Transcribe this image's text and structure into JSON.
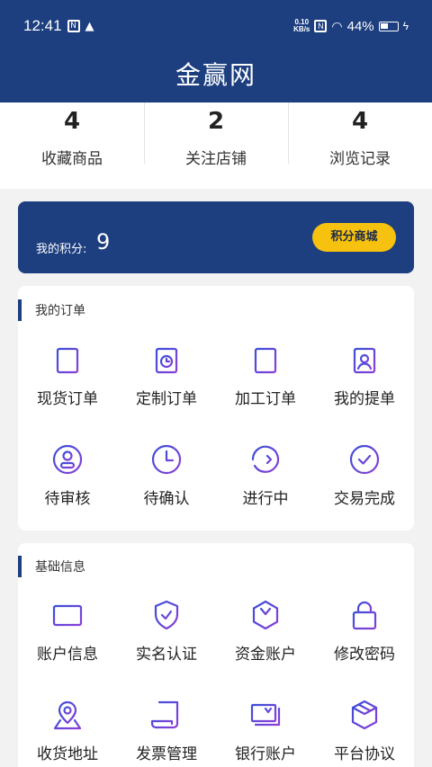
{
  "status_bar": {
    "time": "12:41",
    "speed_top": "0.10",
    "speed_bottom": "KB/s",
    "battery": "44%"
  },
  "header": {
    "title": "金赢网"
  },
  "stats": [
    {
      "value": "4",
      "label": "收藏商品"
    },
    {
      "value": "2",
      "label": "关注店铺"
    },
    {
      "value": "4",
      "label": "浏览记录"
    }
  ],
  "points": {
    "label": "我的积分:",
    "value": "9",
    "button": "积分商城"
  },
  "orders": {
    "title": "我的订单",
    "items": [
      {
        "label": "现货订单",
        "icon": "clipboard-list-icon"
      },
      {
        "label": "定制订单",
        "icon": "clipboard-clock-icon"
      },
      {
        "label": "加工订单",
        "icon": "clipboard-process-icon"
      },
      {
        "label": "我的提单",
        "icon": "clipboard-user-icon"
      },
      {
        "label": "待审核",
        "icon": "user-badge-icon"
      },
      {
        "label": "待确认",
        "icon": "clock-icon"
      },
      {
        "label": "进行中",
        "icon": "progress-arrow-icon"
      },
      {
        "label": "交易完成",
        "icon": "check-circle-icon"
      }
    ]
  },
  "basic": {
    "title": "基础信息",
    "items": [
      {
        "label": "账户信息",
        "icon": "wallet-icon"
      },
      {
        "label": "实名认证",
        "icon": "shield-check-icon"
      },
      {
        "label": "资金账户",
        "icon": "yuan-hexagon-icon"
      },
      {
        "label": "修改密码",
        "icon": "lock-icon"
      },
      {
        "label": "收货地址",
        "icon": "location-icon"
      },
      {
        "label": "发票管理",
        "icon": "receipt-icon"
      },
      {
        "label": "银行账户",
        "icon": "bank-card-icon"
      },
      {
        "label": "平台协议",
        "icon": "package-box-icon"
      }
    ]
  },
  "colors": {
    "brand": "#1d3f7f",
    "accent": "#f7c10f",
    "icon_gradient_start": "#3a4fd8",
    "icon_gradient_end": "#8a3fd8"
  }
}
